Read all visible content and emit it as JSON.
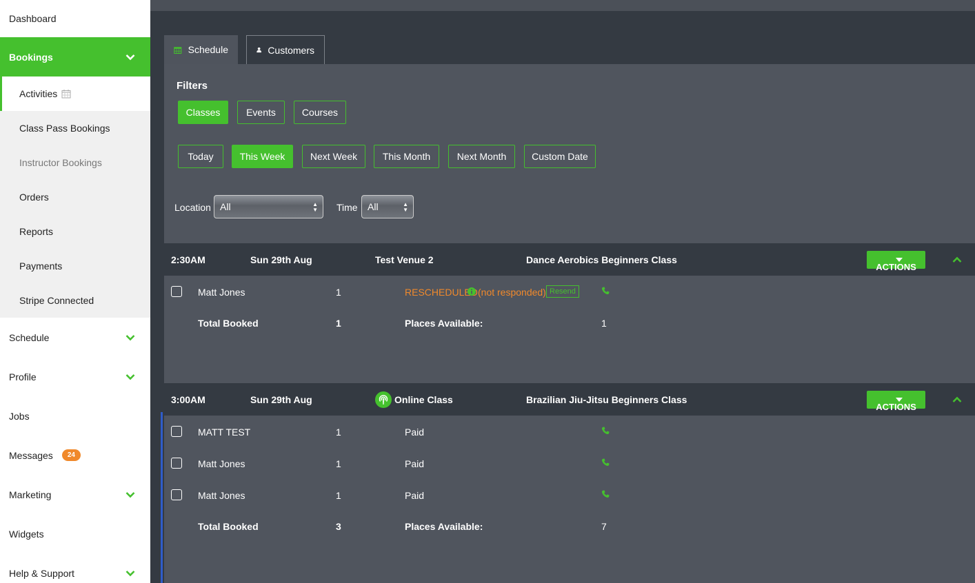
{
  "sidebar": {
    "dashboard": "Dashboard",
    "bookings": "Bookings",
    "sub": {
      "activities": "Activities",
      "class_pass": "Class Pass Bookings",
      "instructor": "Instructor Bookings",
      "orders": "Orders",
      "reports": "Reports",
      "payments": "Payments",
      "stripe": "Stripe Connected"
    },
    "schedule": "Schedule",
    "profile": "Profile",
    "jobs": "Jobs",
    "messages": "Messages",
    "messages_badge": "24",
    "marketing": "Marketing",
    "widgets": "Widgets",
    "help": "Help & Support"
  },
  "tabs": {
    "schedule": "Schedule",
    "customers": "Customers"
  },
  "filters": {
    "label": "Filters",
    "type": [
      "Classes",
      "Events",
      "Courses"
    ],
    "type_selected": "Classes",
    "dates": [
      "Today",
      "This Week",
      "Next Week",
      "This Month",
      "Next Month",
      "Custom Date"
    ],
    "date_selected": "This Week",
    "location_label": "Location",
    "location_value": "All",
    "time_label": "Time",
    "time_value": "All"
  },
  "classes": [
    {
      "time": "2:30AM",
      "date": "Sun 29th Aug",
      "venue": "Test Venue 2",
      "name": "Dance Aerobics Beginners Class",
      "actions": "ACTIONS",
      "rows": [
        {
          "customer": "Matt Jones",
          "qty": "1",
          "status": "RESCHEDULED",
          "status_note": "(not responded)",
          "resend": "Resend"
        }
      ],
      "total_label": "Total Booked",
      "total": "1",
      "places_label": "Places Available:",
      "places": "1"
    },
    {
      "time": "3:00AM",
      "date": "Sun 29th Aug",
      "venue": "Online Class",
      "name": "Brazilian Jiu-Jitsu Beginners Class",
      "actions": "ACTIONS",
      "rows": [
        {
          "customer": "MATT TEST",
          "qty": "1",
          "status": "Paid"
        },
        {
          "customer": "Matt Jones",
          "qty": "1",
          "status": "Paid"
        },
        {
          "customer": "Matt Jones",
          "qty": "1",
          "status": "Paid"
        }
      ],
      "total_label": "Total Booked",
      "total": "3",
      "places_label": "Places Available:",
      "places": "7"
    }
  ],
  "colors": {
    "accent": "#45c02e",
    "warning": "#f0892b",
    "panel": "#50555e",
    "dark": "#343a42"
  }
}
